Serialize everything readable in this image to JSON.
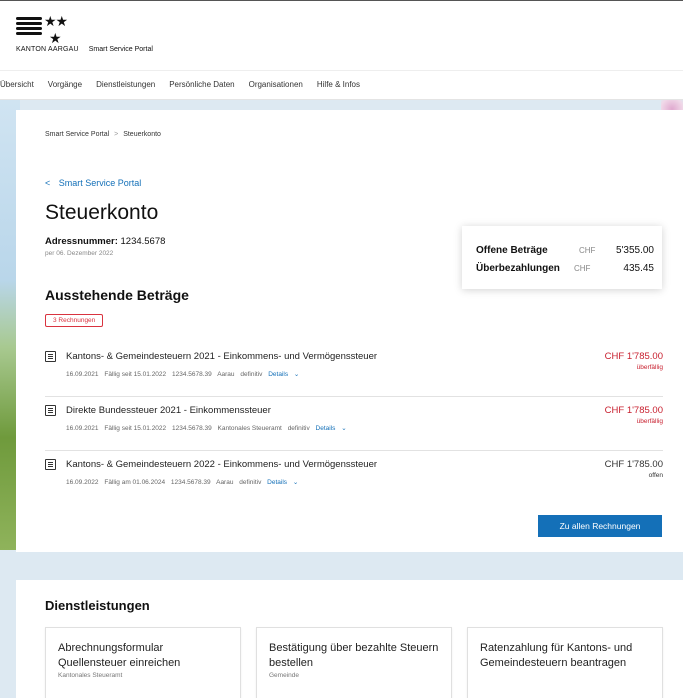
{
  "brand": {
    "kanton": "KANTON AARGAU",
    "portal": "Smart Service Portal"
  },
  "nav": {
    "items": [
      "Übersicht",
      "Vorgänge",
      "Dienstleistungen",
      "Persönliche Daten",
      "Organisationen",
      "Hilfe & Infos"
    ]
  },
  "breadcrumb": {
    "root": "Smart Service Portal",
    "separator": ">",
    "current": "Steuerkonto"
  },
  "back_link": {
    "chevron": "<",
    "label": "Smart Service Portal"
  },
  "page": {
    "title": "Steuerkonto",
    "address_label": "Adressnummer:",
    "address_value": "1234.5678",
    "date": "per 06. Dezember 2022"
  },
  "summary": {
    "open_label": "Offene Beträge",
    "open_currency": "CHF",
    "open_amount": "5'355.00",
    "over_label": "Überbezahlungen",
    "over_currency": "CHF",
    "over_amount": "435.45"
  },
  "outstanding": {
    "title": "Ausstehende Beträge",
    "badge": "3 Rechnungen",
    "invoices": [
      {
        "title": "Kantons- & Gemeindesteuern 2021 - Einkommens- und Vermögenssteuer",
        "date": "16.09.2021",
        "due": "Fällig seit 15.01.2022",
        "ref": "1234.5678.39",
        "place": "Aarau",
        "state": "definitiv",
        "details": "Details",
        "amount": "CHF 1'785.00",
        "status": "überfällig"
      },
      {
        "title": "Direkte Bundessteuer 2021 - Einkommenssteuer",
        "date": "16.09.2021",
        "due": "Fällig seit 15.01.2022",
        "ref": "1234.5678.39",
        "place": "Kantonales Steueramt",
        "state": "definitiv",
        "details": "Details",
        "amount": "CHF 1'785.00",
        "status": "überfällig"
      },
      {
        "title": "Kantons- & Gemeindesteuern 2022 - Einkommens- und Vermögenssteuer",
        "date": "16.09.2022",
        "due": "Fällig am 01.06.2024",
        "ref": "1234.5678.39",
        "place": "Aarau",
        "state": "definitiv",
        "details": "Details",
        "amount": "CHF 1'785.00",
        "status": "offen"
      }
    ],
    "cta": "Zu allen Rechnungen"
  },
  "services": {
    "title": "Dienstleistungen",
    "tiles": [
      {
        "title": "Abrechnungsformular Quellensteuer einreichen",
        "subtitle": "Kantonales Steueramt"
      },
      {
        "title": "Bestätigung über bezahlte Steuern bestellen",
        "subtitle": "Gemeinde"
      },
      {
        "title": "Ratenzahlung für Kantons- und Gemeindesteuern beantragen",
        "subtitle": ""
      }
    ]
  },
  "colors": {
    "accent": "#1470b8",
    "overdue": "#c8202f",
    "page_bg": "#dde9f2"
  },
  "icons": {
    "invoice": "document-icon",
    "details": "chevron-down-icon",
    "back": "chevron-left-icon"
  }
}
